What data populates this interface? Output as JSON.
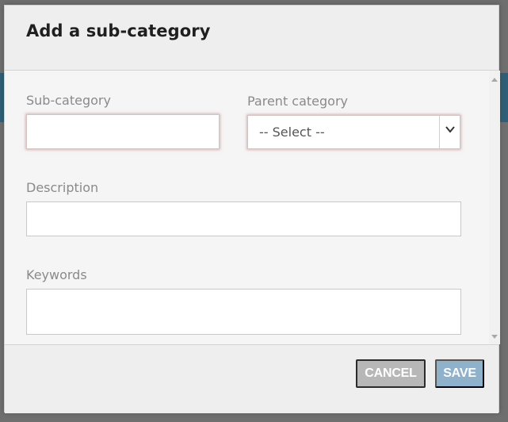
{
  "modal": {
    "title": "Add a sub-category"
  },
  "fields": {
    "subcategory": {
      "label": "Sub-category",
      "value": ""
    },
    "parent_category": {
      "label": "Parent category",
      "selected": "-- Select --"
    },
    "description": {
      "label": "Description",
      "value": ""
    },
    "keywords": {
      "label": "Keywords",
      "value": ""
    }
  },
  "buttons": {
    "cancel_label": "CANCEL",
    "save_label": "SAVE"
  },
  "colors": {
    "save_button": "#8fb2cc",
    "cancel_button": "#b7b7b7",
    "invalid_glow": "#d29696"
  },
  "icons": {
    "select_arrow": "chevron-down-icon",
    "scroll_up": "scroll-up-arrow-icon",
    "scroll_down": "scroll-down-arrow-icon"
  }
}
